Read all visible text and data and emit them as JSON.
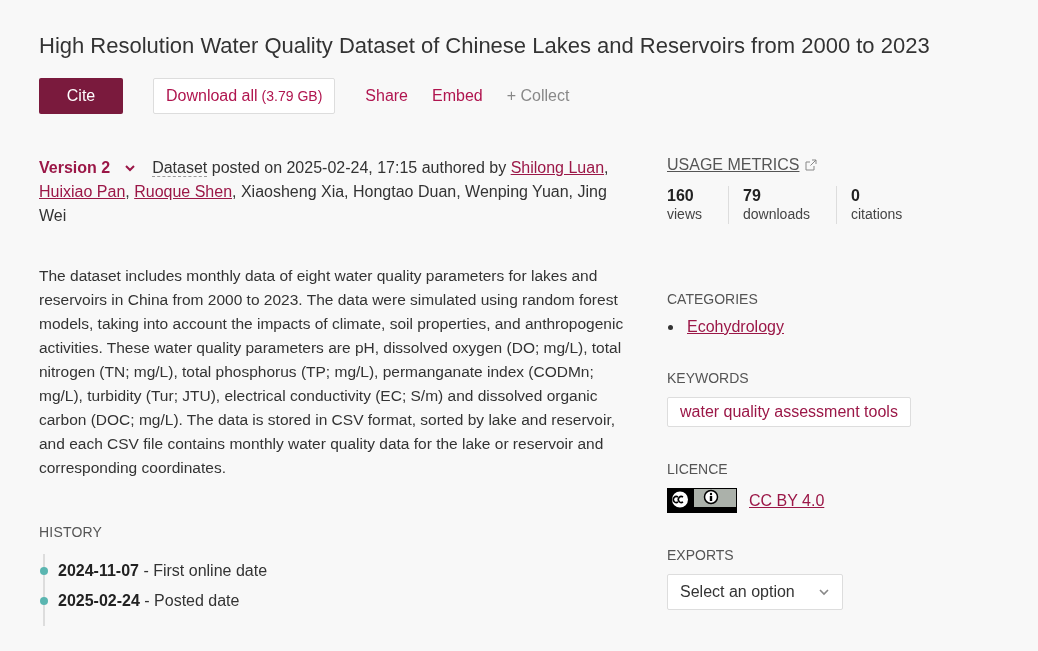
{
  "title": "High Resolution Water Quality Dataset of Chinese Lakes and Reservoirs from 2000 to 2023",
  "actions": [
    {
      "kind": "primary",
      "label": "Cite"
    },
    {
      "kind": "outline",
      "label": "Download all",
      "note": "(3.79 GB)"
    },
    {
      "kind": "link",
      "label": "Share"
    },
    {
      "kind": "link",
      "label": "Embed"
    },
    {
      "kind": "muted",
      "label": "+ Collect"
    }
  ],
  "version": {
    "label": "Version 2"
  },
  "byline": {
    "item_type": "Dataset",
    "posted": " posted on 2025-02-24, 17:15 authored by ",
    "separator": ", ",
    "authors": [
      {
        "name": "Shilong Luan",
        "linked": true
      },
      {
        "name": "Huixiao Pan",
        "linked": true
      },
      {
        "name": "Ruoque Shen",
        "linked": true
      },
      {
        "name": "Xiaosheng Xia",
        "linked": false
      },
      {
        "name": "Hongtao Duan",
        "linked": false
      },
      {
        "name": "Wenping Yuan",
        "linked": false
      },
      {
        "name": "Jing Wei",
        "linked": false
      }
    ]
  },
  "description": "The dataset includes monthly data of eight water quality parameters for lakes and reservoirs in China from 2000 to 2023. The data were simulated using random forest models, taking into account the impacts of climate, soil properties, and anthropogenic activities. These water quality parameters are pH, dissolved oxygen (DO; mg/L), total nitrogen (TN; mg/L), total phosphorus (TP; mg/L), permanganate index (CODMn; mg/L), turbidity (Tur; JTU), electrical conductivity (EC; S/m) and dissolved organic carbon (DOC; mg/L). The data is stored in CSV format, sorted by lake and reservoir, and each CSV file contains monthly water quality data for the lake or reservoir and corresponding coordinates.",
  "history": {
    "heading": "HISTORY",
    "events": [
      {
        "date": "2024-11-07",
        "label": " - First online date"
      },
      {
        "date": "2025-02-24",
        "label": " - Posted date"
      }
    ]
  },
  "usage_metrics": {
    "heading": "USAGE METRICS",
    "metrics": [
      {
        "value": "160",
        "label": "views"
      },
      {
        "value": "79",
        "label": "downloads"
      },
      {
        "value": "0",
        "label": "citations"
      }
    ]
  },
  "categories": {
    "heading": "CATEGORIES",
    "items": [
      "Ecohydrology"
    ]
  },
  "keywords": {
    "heading": "KEYWORDS",
    "items": [
      "water quality assessment tools"
    ]
  },
  "licence": {
    "heading": "LICENCE",
    "name": "CC BY 4.0"
  },
  "exports": {
    "heading": "EXPORTS",
    "placeholder": "Select an option"
  }
}
